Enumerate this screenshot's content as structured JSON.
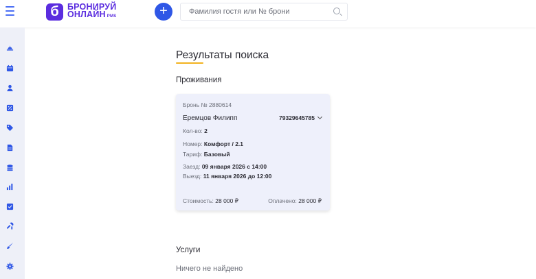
{
  "header": {
    "logo": {
      "line1": "БРОНИРУЙ",
      "line2": "ОНЛАЙН",
      "suffix": "PMS",
      "mark": "б"
    },
    "add_button": "+",
    "search": {
      "placeholder": "Фамилия гостя или № брони",
      "value": ""
    }
  },
  "sidebar": {
    "items": [
      {
        "icon": "bell-icon"
      },
      {
        "icon": "calendar-icon"
      },
      {
        "icon": "user-icon"
      },
      {
        "icon": "percent-icon"
      },
      {
        "icon": "tag-icon"
      },
      {
        "icon": "document-icon"
      },
      {
        "icon": "coins-icon"
      },
      {
        "icon": "bar-chart-icon"
      },
      {
        "icon": "checkbox-icon"
      },
      {
        "icon": "tools-icon"
      },
      {
        "icon": "brush-icon"
      },
      {
        "icon": "gear-icon"
      }
    ]
  },
  "page": {
    "title": "Результаты поиска",
    "accent_color": "#f2b21d"
  },
  "stays": {
    "title": "Проживания",
    "card": {
      "booking": "Бронь № 2880614",
      "guest_name": "Еремцов Филипп",
      "phone": "79329645785",
      "count_label": "Кол-во:",
      "count_value": "2",
      "room_label": "Номер:",
      "room_value": "Комфорт / 2.1",
      "tariff_label": "Тариф:",
      "tariff_value": "Базовый",
      "checkin_label": "Заезд:",
      "checkin_value": "09 января 2026 с 14:00",
      "checkout_label": "Выезд:",
      "checkout_value": "11 января 2026 до 12:00",
      "cost_label": "Стоимость:",
      "cost_value": "28 000 ₽",
      "paid_label": "Оплачено:",
      "paid_value": "28 000 ₽"
    }
  },
  "services": {
    "title": "Услуги",
    "empty_text": "Ничего не найдено"
  },
  "colors": {
    "brand": "#5b2ddf",
    "primary": "#2f57e6",
    "sidebar_bg": "#eef0f8",
    "card_bg": "#eef0fb"
  }
}
